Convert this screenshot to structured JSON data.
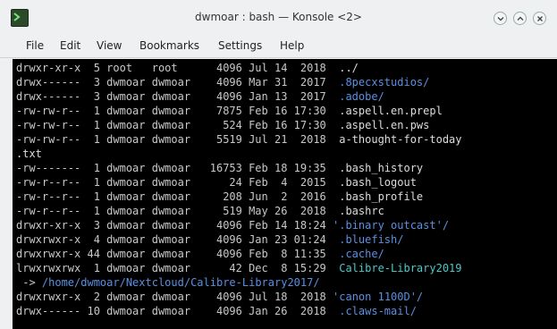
{
  "window": {
    "title": "dwmoar : bash — Konsole <2>",
    "buttons": [
      "minimize",
      "maximize",
      "close"
    ]
  },
  "menubar": {
    "items": [
      "File",
      "Edit",
      "View",
      "Bookmarks",
      "Settings",
      "Help"
    ]
  },
  "terminal": {
    "lines": [
      {
        "text": "drwxr-xr-x  5 root   root      4096 Jul 14  2018  ",
        "name": "../",
        "color": "white"
      },
      {
        "text": "drwx------  3 dwmoar dwmoar    4096 Mar 31  2017  ",
        "name": ".8pecxstudios/",
        "color": "blue"
      },
      {
        "text": "drwx------  3 dwmoar dwmoar    4096 Jan 13  2017  ",
        "name": ".adobe/",
        "color": "blue"
      },
      {
        "text": "-rw-rw-r--  1 dwmoar dwmoar    7875 Feb 16 17:30  ",
        "name": ".aspell.en.prepl",
        "color": "white"
      },
      {
        "text": "-rw-rw-r--  1 dwmoar dwmoar     524 Feb 16 17:30  ",
        "name": ".aspell.en.pws",
        "color": "white"
      },
      {
        "text": "-rw-rw-r--  1 dwmoar dwmoar    5519 Jul 21  2018  ",
        "name": "a-thought-for-today",
        "color": "white"
      },
      {
        "text": "",
        "name": ".txt",
        "color": "white"
      },
      {
        "text": "-rw-------  1 dwmoar dwmoar   16753 Feb 18 19:35  ",
        "name": ".bash_history",
        "color": "white"
      },
      {
        "text": "-rw-r--r--  1 dwmoar dwmoar      24 Feb  4  2015  ",
        "name": ".bash_logout",
        "color": "white"
      },
      {
        "text": "-rw-r--r--  1 dwmoar dwmoar     208 Jun  2  2016  ",
        "name": ".bash_profile",
        "color": "white"
      },
      {
        "text": "-rw-r--r--  1 dwmoar dwmoar     519 May 26  2018  ",
        "name": ".bashrc",
        "color": "white"
      },
      {
        "text": "drwxr-xr-x  3 dwmoar dwmoar    4096 Feb 14 18:24 ",
        "name": "'.binary outcast'/",
        "color": "blue"
      },
      {
        "text": "drwxrwxr-x  4 dwmoar dwmoar    4096 Jan 23 01:24  ",
        "name": ".bluefish/",
        "color": "blue"
      },
      {
        "text": "drwxrwxr-x 44 dwmoar dwmoar    4096 Feb  8 11:35  ",
        "name": ".cache/",
        "color": "blue"
      },
      {
        "text": "lrwxrwxrwx  1 dwmoar dwmoar      42 Dec  8 15:29  ",
        "name": "Calibre-Library2019",
        "color": "cyan"
      },
      {
        "text": " -> ",
        "name": "/home/dwmoar/Nextcloud/Calibre-Library2017/",
        "color": "blue"
      },
      {
        "text": "drwxrwxr-x  2 dwmoar dwmoar    4096 Jul 18  2018 ",
        "name": "'canon 1100D'/",
        "color": "blue"
      },
      {
        "text": "drwx------ 10 dwmoar dwmoar    4096 Jan 26  2018  ",
        "name": ".claws-mail/",
        "color": "blue"
      }
    ]
  }
}
